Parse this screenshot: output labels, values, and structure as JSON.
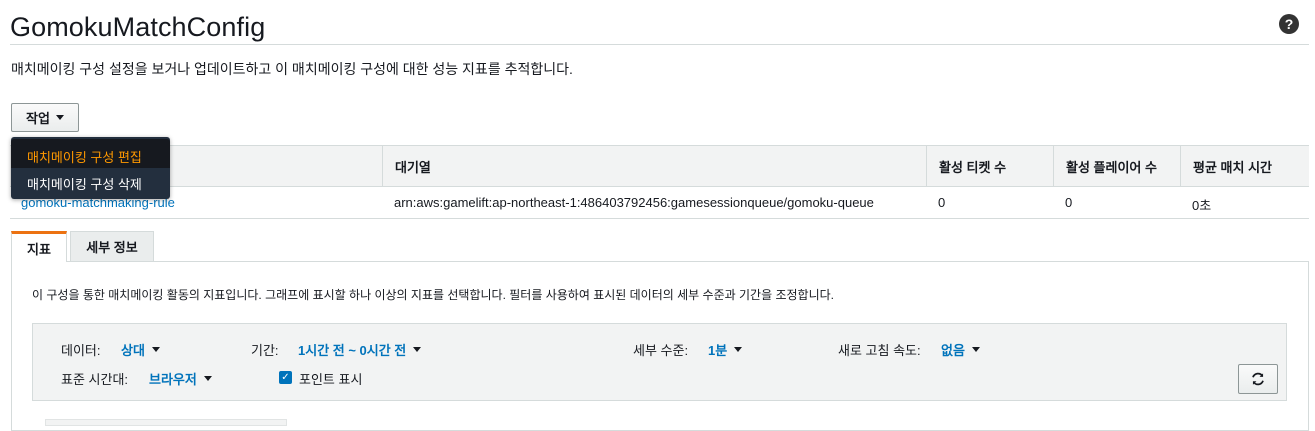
{
  "header": {
    "title": "GomokuMatchConfig",
    "subtitle": "매치메이킹 구성 설정을 보거나 업데이트하고 이 매치메이킹 구성에 대한 성능 지표를 추적합니다.",
    "help_icon": "question-circle-icon"
  },
  "actions": {
    "button_label": "작업",
    "menu": [
      {
        "label": "매치메이킹 구성 편집",
        "state": "highlighted"
      },
      {
        "label": "매치메이킹 구성 삭제",
        "state": "normal"
      }
    ]
  },
  "table": {
    "columns": [
      "",
      "대기열",
      "활성 티켓 수",
      "활성 플레이어 수",
      "평균 매치 시간"
    ],
    "rows": [
      {
        "rule_set": "gomoku-matchmaking-rule",
        "queue": "arn:aws:gamelift:ap-northeast-1:486403792456:gamesessionqueue/gomoku-queue",
        "active_tickets": "0",
        "active_players": "0",
        "avg_match_time": "0초"
      }
    ]
  },
  "tabs": [
    {
      "label": "지표",
      "active": true
    },
    {
      "label": "세부 정보",
      "active": false
    }
  ],
  "metrics": {
    "description": "이 구성을 통한 매치메이킹 활동의 지표입니다. 그래프에 표시할 하나 이상의 지표를 선택합니다. 필터를 사용하여 표시된 데이터의 세부 수준과 기간을 조정합니다.",
    "controls": {
      "data_label": "데이터:",
      "data_value": "상대",
      "period_label": "기간:",
      "period_value": "1시간 전 ~ 0시간 전",
      "detail_label": "세부 수준:",
      "detail_value": "1분",
      "refresh_label": "새로 고침 속도:",
      "refresh_value": "없음",
      "timezone_label": "표준 시간대:",
      "timezone_value": "브라우저",
      "show_points_label": "포인트 표시",
      "show_points_checked": true,
      "refresh_icon": "refresh-icon"
    }
  },
  "colors": {
    "link": "#0073bb",
    "accent": "#ec7211",
    "menu_bg": "#232f3e",
    "menu_highlight": "#ff9900"
  }
}
